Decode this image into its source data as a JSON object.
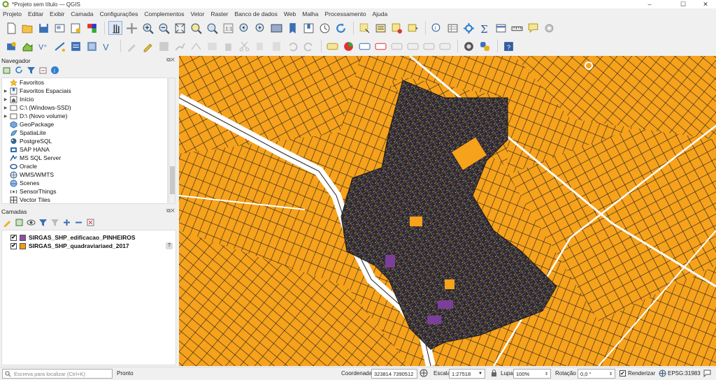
{
  "window": {
    "title": "*Projeto sem título — QGIS",
    "controls": {
      "minimize": "–",
      "maximize": "☐",
      "close": "✕"
    }
  },
  "menu": [
    "Projeto",
    "Editar",
    "Exibir",
    "Camada",
    "Configurações",
    "Complementos",
    "Vetor",
    "Raster",
    "Banco de dados",
    "Web",
    "Malha",
    "Processamento",
    "Ajuda"
  ],
  "browser": {
    "title": "Navegador",
    "items": [
      {
        "label": "Favoritos",
        "icon": "star-icon",
        "expandable": false
      },
      {
        "label": "Favoritos Espaciais",
        "icon": "spatial-bookmark-icon",
        "expandable": true
      },
      {
        "label": "Início",
        "icon": "home-icon",
        "expandable": true
      },
      {
        "label": "C:\\ (Windows-SSD)",
        "icon": "drive-icon",
        "expandable": true
      },
      {
        "label": "D:\\ (Novo volume)",
        "icon": "drive-icon",
        "expandable": true
      },
      {
        "label": "GeoPackage",
        "icon": "geopackage-icon",
        "expandable": false
      },
      {
        "label": "SpatiaLite",
        "icon": "spatialite-icon",
        "expandable": false
      },
      {
        "label": "PostgreSQL",
        "icon": "postgresql-icon",
        "expandable": false
      },
      {
        "label": "SAP HANA",
        "icon": "sap-hana-icon",
        "expandable": false
      },
      {
        "label": "MS SQL Server",
        "icon": "mssql-icon",
        "expandable": false
      },
      {
        "label": "Oracle",
        "icon": "oracle-icon",
        "expandable": false
      },
      {
        "label": "WMS/WMTS",
        "icon": "wms-icon",
        "expandable": false
      },
      {
        "label": "Scenes",
        "icon": "scenes-icon",
        "expandable": false
      },
      {
        "label": "SensorThings",
        "icon": "sensorthings-icon",
        "expandable": false
      },
      {
        "label": "Vector Tiles",
        "icon": "vector-tiles-icon",
        "expandable": false
      }
    ]
  },
  "layers": {
    "title": "Camadas",
    "items": [
      {
        "label": "SIRGAS_SHP_edificacao_PINHEIROS",
        "color": "#8e4fa0",
        "checked": true
      },
      {
        "label": "SIRGAS_SHP_quadraviariaed_2017",
        "color": "#f39c12",
        "checked": true
      }
    ]
  },
  "colors": {
    "map_fill": "#f7a21b",
    "block_dark": "#2d2b2b",
    "building": "#7b3f99",
    "road": "#ffffff"
  },
  "status": {
    "search_placeholder": "Escreva para localizar (Ctrl+K)",
    "ready": "Pronto",
    "coord_label": "Coordenada",
    "coord_value": "323814  7390512",
    "scale_label": "Escala",
    "scale_value": "1:27518",
    "magnifier_label": "Lupa",
    "magnifier_value": "100%",
    "rotation_label": "Rotação",
    "rotation_value": "0,0 °",
    "render_label": "Renderizar",
    "crs": "EPSG:31983"
  }
}
